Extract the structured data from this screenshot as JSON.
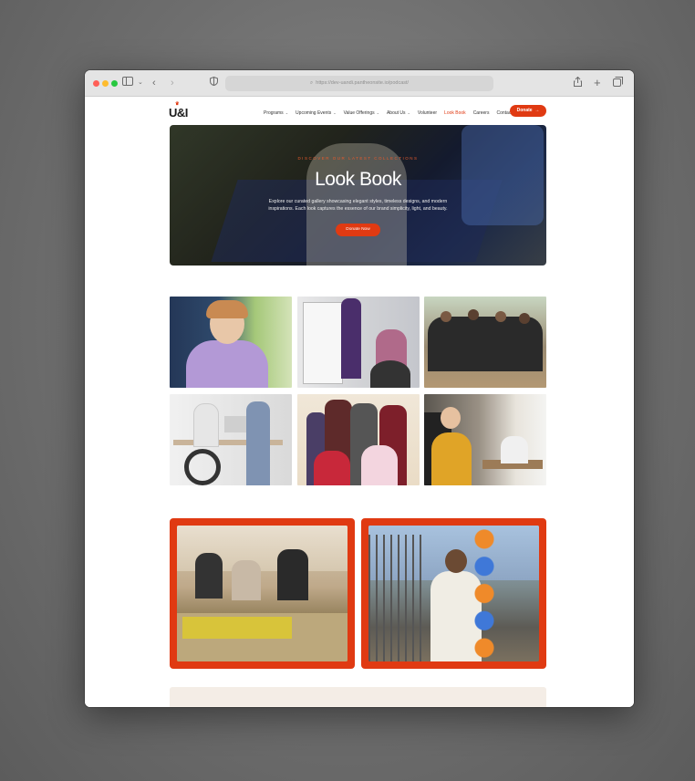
{
  "browser": {
    "url": "https://dev-uandi.pantheonsite.io/podcast/"
  },
  "site": {
    "logo": "U&I",
    "nav": [
      {
        "label": "Programs",
        "dropdown": true,
        "active": false
      },
      {
        "label": "Upcoming Events",
        "dropdown": true,
        "active": false
      },
      {
        "label": "Value Offerings",
        "dropdown": true,
        "active": false
      },
      {
        "label": "About Us",
        "dropdown": true,
        "active": false
      },
      {
        "label": "Volunteer",
        "dropdown": false,
        "active": false
      },
      {
        "label": "Look Book",
        "dropdown": false,
        "active": true
      },
      {
        "label": "Careers",
        "dropdown": false,
        "active": false
      },
      {
        "label": "Contact",
        "dropdown": false,
        "active": false
      }
    ],
    "donate_label": "Donate",
    "accent_color": "#e03a12"
  },
  "hero": {
    "eyebrow": "DISCOVER OUR LATEST COLLECTIONS",
    "title": "Look Book",
    "text": "Explore our curated gallery showcasing elegant styles, timeless designs, and modern inspirations. Each look captures the essence of our brand simplicity, light, and beauty.",
    "button_label": "Donate Now"
  },
  "gallery": {
    "count": 6
  },
  "featured": {
    "count": 2
  }
}
